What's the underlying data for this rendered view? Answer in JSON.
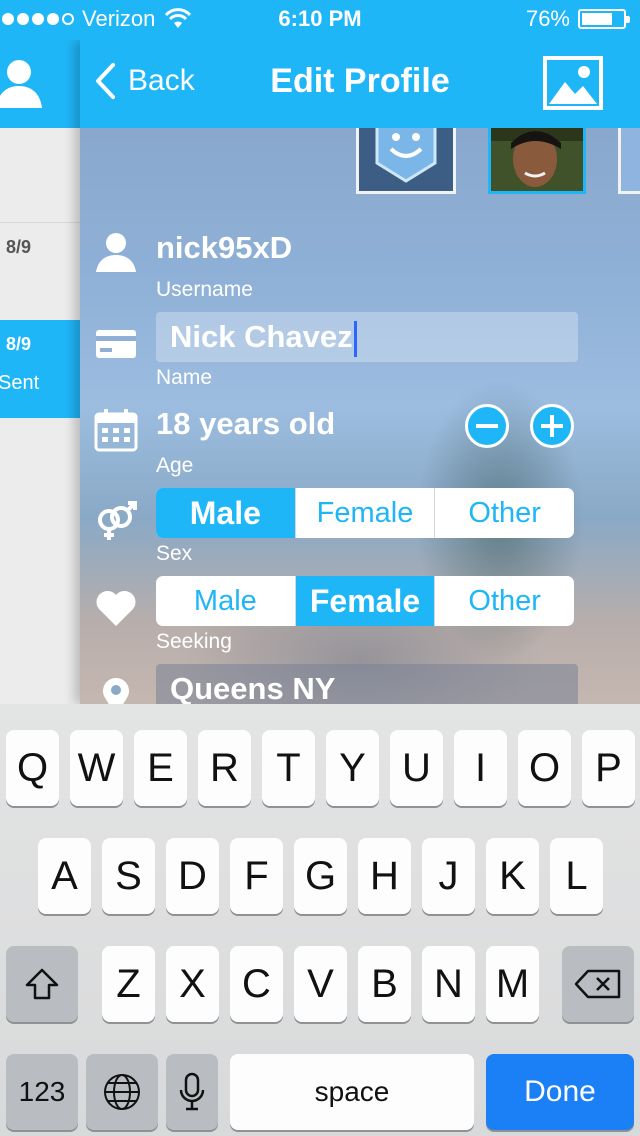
{
  "status_bar": {
    "carrier": "Verizon",
    "time": "6:10 PM",
    "battery": "76%",
    "battery_level": 0.76,
    "signal_bars": 4
  },
  "drawer": {
    "items": [
      {
        "date": "8/9",
        "status": "",
        "active": false
      },
      {
        "date": "8/9",
        "status": "Sent",
        "active": true
      }
    ]
  },
  "navbar": {
    "back_label": "Back",
    "title": "Edit Profile",
    "photo_button_icon": "image-icon"
  },
  "profile": {
    "username": "nick95xD",
    "username_label": "Username",
    "name": "Nick Chavez",
    "name_label": "Name",
    "age": "18 years old",
    "age_label": "Age",
    "sex_label": "Sex",
    "sex_options": [
      "Male",
      "Female",
      "Other"
    ],
    "sex_selected": "Male",
    "seeking_label": "Seeking",
    "seeking_options": [
      "Male",
      "Female",
      "Other"
    ],
    "seeking_selected": "Female",
    "location": "Queens NY"
  },
  "keyboard": {
    "row1": [
      "Q",
      "W",
      "E",
      "R",
      "T",
      "Y",
      "U",
      "I",
      "O",
      "P"
    ],
    "row2": [
      "A",
      "S",
      "D",
      "F",
      "G",
      "H",
      "J",
      "K",
      "L"
    ],
    "row3": [
      "Z",
      "X",
      "C",
      "V",
      "B",
      "N",
      "M"
    ],
    "numbers_label": "123",
    "space_label": "space",
    "done_label": "Done"
  },
  "colors": {
    "accent": "#1fb6f7",
    "done_key": "#1b7ff5"
  }
}
